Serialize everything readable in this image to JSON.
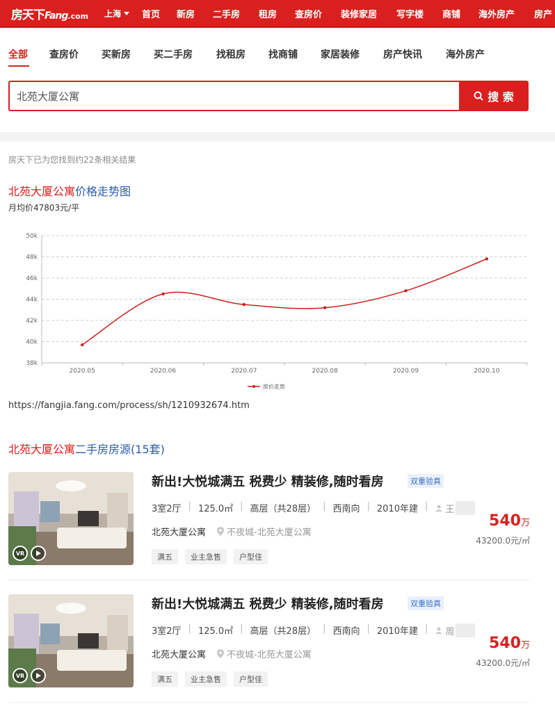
{
  "topnav": {
    "logo": {
      "cn": "房天下",
      "en": "Fang",
      "dot": ".com"
    },
    "city": "上海",
    "links": [
      "首页",
      "新房",
      "二手房",
      "租房",
      "查房价",
      "装修家居",
      "写字楼",
      "商铺",
      "海外房产",
      "房产"
    ]
  },
  "tabs": [
    "全部",
    "查房价",
    "买新房",
    "买二手房",
    "找租房",
    "找商铺",
    "家居装修",
    "房产快讯",
    "海外房产"
  ],
  "search": {
    "value": "北苑大厦公寓",
    "button": "搜 索"
  },
  "result_count": "房天下已为您找到约22条相关结果",
  "trend": {
    "keyword": "北苑大厦公寓",
    "title_rest": "价格走势图",
    "avg_price": "月均价47803元/平",
    "legend": "房价走势"
  },
  "chart_data": {
    "type": "line",
    "title": "北苑大厦公寓价格走势图",
    "categories": [
      "2020.05",
      "2020.06",
      "2020.07",
      "2020.08",
      "2020.09",
      "2020.10"
    ],
    "series": [
      {
        "name": "房价走势",
        "values": [
          39700,
          44500,
          43500,
          43200,
          44800,
          47803
        ]
      }
    ],
    "yticks": [
      "38k",
      "40k",
      "42k",
      "44k",
      "46k",
      "48k",
      "50k"
    ],
    "ylim": [
      38000,
      50000
    ],
    "grid": true,
    "line_color": "#c8201e",
    "legend_position": "bottom-center"
  },
  "source_url": "https://fangjia.fang.com/process/sh/1210932674.htm",
  "list_title": {
    "keyword": "北苑大厦公寓",
    "rest": "二手房房源(15套)"
  },
  "listings": [
    {
      "title": "新出!大悦城满五 税费少 精装修,随时看房",
      "badge": "双重验真",
      "layout": "3室2厅",
      "area": "125.0㎡",
      "floor": "高层（共28层）",
      "orientation": "西南向",
      "year": "2010年建",
      "agent": "王",
      "community": "北苑大厦公寓",
      "district": "不夜城-北苑大厦公寓",
      "tags": [
        "满五",
        "业主急售",
        "户型佳"
      ],
      "price": "540",
      "price_unit": "万",
      "unit_price": "43200.0元/㎡",
      "vr_label": "VR"
    },
    {
      "title": "新出!大悦城满五 税费少 精装修,随时看房",
      "badge": "双重验真",
      "layout": "3室2厅",
      "area": "125.0㎡",
      "floor": "高层（共28层）",
      "orientation": "西南向",
      "year": "2010年建",
      "agent": "周",
      "community": "北苑大厦公寓",
      "district": "不夜城-北苑大厦公寓",
      "tags": [
        "满五",
        "业主急售",
        "户型佳"
      ],
      "price": "540",
      "price_unit": "万",
      "unit_price": "43200.0元/㎡",
      "vr_label": "VR"
    }
  ]
}
